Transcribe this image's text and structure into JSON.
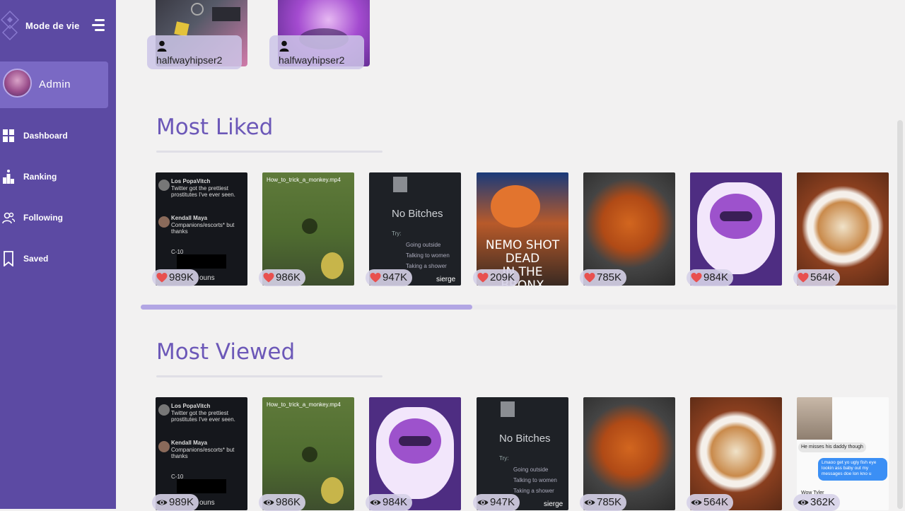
{
  "app": {
    "title": "Mode de vie"
  },
  "user": {
    "name": "Admin"
  },
  "nav": [
    {
      "label": "Dashboard",
      "icon": "grid-icon"
    },
    {
      "label": "Ranking",
      "icon": "ranking-icon"
    },
    {
      "label": "Following",
      "icon": "users-icon"
    },
    {
      "label": "Saved",
      "icon": "bookmark-icon"
    }
  ],
  "recent": [
    {
      "owner": "halfwayhipser2",
      "image": "desk-setup"
    },
    {
      "owner": "halfwayhipser2",
      "image": "purple-raccoon"
    }
  ],
  "most_liked": {
    "title": "Most Liked",
    "items": [
      {
        "count": "989K",
        "image": "tweet-screenshot"
      },
      {
        "count": "986K",
        "image": "monkey-video"
      },
      {
        "count": "947K",
        "image": "no-bitches-meme"
      },
      {
        "count": "209K",
        "image": "nemo-meme"
      },
      {
        "count": "785K",
        "image": "food-pan"
      },
      {
        "count": "984K",
        "image": "purple-raccoon"
      },
      {
        "count": "564K",
        "image": "latte-art"
      }
    ]
  },
  "most_viewed": {
    "title": "Most Viewed",
    "items": [
      {
        "count": "989K",
        "image": "tweet-screenshot"
      },
      {
        "count": "986K",
        "image": "monkey-video"
      },
      {
        "count": "984K",
        "image": "purple-raccoon"
      },
      {
        "count": "947K",
        "image": "no-bitches-meme"
      },
      {
        "count": "785K",
        "image": "food-pan"
      },
      {
        "count": "564K",
        "image": "latte-art"
      },
      {
        "count": "362K",
        "image": "chat-screenshot"
      }
    ]
  },
  "image_text": {
    "tweet_user1": "Los PopaVitch",
    "tweet_body1": "Twitter got the prettiest prostitutes I've ever seen.",
    "tweet_user2": "Kendall Maya",
    "tweet_body2": "Companions/escorts* but thanks",
    "tweet_user3": "C-10",
    "tweet_tail": "ouns",
    "video_name": "How_to_trick_a_monkey.mp4",
    "no_bitches": "No Bitches",
    "try": "Try:",
    "try_items": [
      "Going outside",
      "Talking to women",
      "Taking a shower"
    ],
    "watermark": "sierge",
    "nemo_line1": "NEMO SHOT DEAD",
    "nemo_line2": "IN THE BRONX",
    "chat1": "He misses his daddy though",
    "chat2": "Lmaoo get yo ugly fish eye lookin ass baby out my messages doe lon kno u",
    "chat3": "Wow Tyler"
  },
  "colors": {
    "sidebar": "#5c4aa3",
    "accent": "#6c58b8",
    "heart": "#e8504f"
  }
}
